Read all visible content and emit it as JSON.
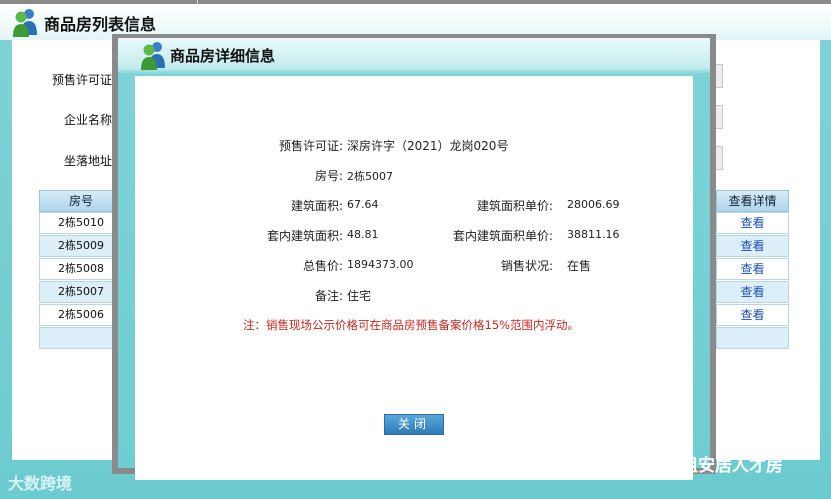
{
  "background": {
    "title": "商品房列表信息",
    "form": {
      "presale_label": "预售许可证:",
      "company_label": "企业名称:",
      "address_label": "坐落地址:"
    },
    "table": {
      "col_room": "房号",
      "col_detail": "查看详情",
      "rows": [
        {
          "room": "2栋5010",
          "action": "查看"
        },
        {
          "room": "2栋5009",
          "action": "查看"
        },
        {
          "room": "2栋5008",
          "action": "查看"
        },
        {
          "room": "2栋5007",
          "action": "查看"
        },
        {
          "room": "2栋5006",
          "action": "查看"
        }
      ]
    }
  },
  "modal": {
    "title": "商品房详细信息",
    "fields": {
      "presale_label": "预售许可证:",
      "presale_value": "深房许字（2021）龙岗020号",
      "room_label": "房号:",
      "room_value": "2栋5007",
      "area_label": "建筑面积:",
      "area_value": "67.64",
      "area_price_label": "建筑面积单价:",
      "area_price_value": "28006.69",
      "inner_area_label": "套内建筑面积:",
      "inner_area_value": "48.81",
      "inner_price_label": "套内建筑面积单价:",
      "inner_price_value": "38811.16",
      "total_label": "总售价:",
      "total_value": "1894373.00",
      "status_label": "销售状况:",
      "status_value": "在售",
      "remark_label": "备注:",
      "remark_value": "住宅"
    },
    "notice": "注：销售现场公示价格可在商品房预售备案价格15%范围内浮动。",
    "close_label": "关闭"
  },
  "watermarks": {
    "left": "大数跨境",
    "right": "公租安居人才房"
  },
  "colors": {
    "teal_frame": "#6ecdd2",
    "notice_red": "#c0281e",
    "link_blue": "#1a4fb5",
    "button_blue": "#2f79b8"
  }
}
